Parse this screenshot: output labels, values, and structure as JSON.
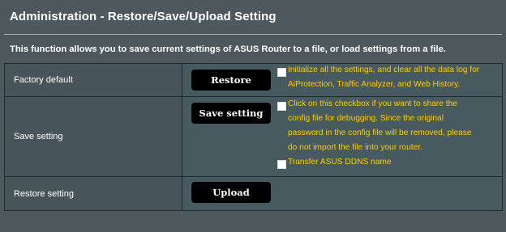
{
  "header": {
    "title": "Administration - Restore/Save/Upload Setting",
    "description": "This function allows you to save current settings of ASUS Router to a file, or load settings from a file."
  },
  "rows": {
    "factory_default": {
      "label": "Factory default",
      "button_label": "Restore",
      "checkbox_text_line1": "Initialize all the settings, and clear all the data log for",
      "checkbox_text_line2": "AiProtection, Traffic Analyzer, and Web History.",
      "checkbox_checked": false
    },
    "save_setting": {
      "label": "Save setting",
      "button_label": "Save setting",
      "share_text_line1": "Click on this checkbox if you want to share the",
      "share_text_line2": "config file for debugging. Since the original",
      "share_text_line3": "password in the config file will be removed, please",
      "share_text_line4": "do not import the file into your router.",
      "share_checked": false,
      "ddns_text": "Transfer ASUS DDNS name",
      "ddns_checked": false
    },
    "restore_setting": {
      "label": "Restore setting",
      "button_label": "Upload"
    }
  },
  "colors": {
    "background": "#4d595d",
    "warning_text": "#ffcc00",
    "button": "#000000"
  }
}
